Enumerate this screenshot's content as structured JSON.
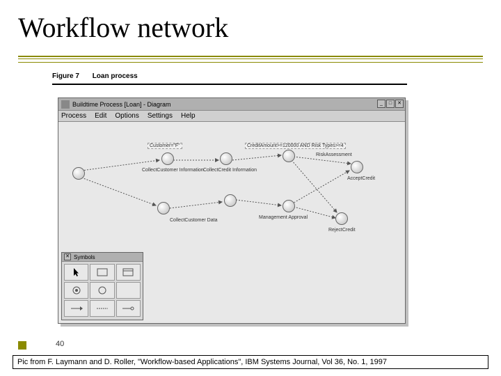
{
  "slide": {
    "title": "Workflow network",
    "number": "40"
  },
  "figure": {
    "number": "Figure 7",
    "caption": "Loan process"
  },
  "app_window": {
    "title": "Buildtime Process [Loan] - Diagram",
    "menu": {
      "process": "Process",
      "edit": "Edit",
      "options": "Options",
      "settings": "Settings",
      "help": "Help"
    },
    "controls": {
      "min": "_",
      "max": "□",
      "close": "✕"
    }
  },
  "workflow": {
    "nodes": {
      "collect_customer_info": "CollectCustomer Information",
      "collect_credit_info": "CollectCredit Information",
      "collect_customer_data": "CollectCustomer Data",
      "risk_assessment": "RiskAssessment",
      "management_approval": "Management Approval",
      "accept_credit": "AcceptCredit",
      "reject_credit": "RejectCredit"
    },
    "edges": {
      "customer_f": "Customer=\"F\"",
      "credit_amount": "CreditAmount>=120000 AND Risk Types>=4"
    }
  },
  "palette": {
    "title": "Symbols"
  },
  "citation": "Pic from F. Laymann and D. Roller, \"Workflow-based Applications\", IBM Systems Journal, Vol 36, No. 1, 1997"
}
